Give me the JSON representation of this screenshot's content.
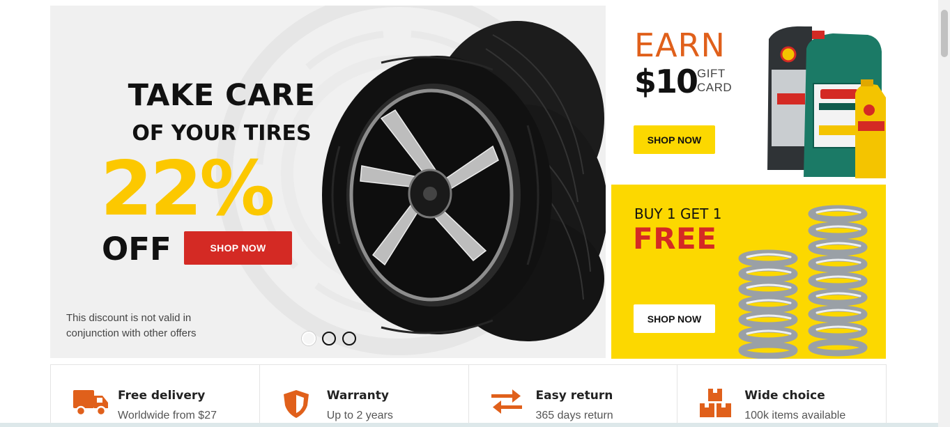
{
  "hero": {
    "title_line1": "TAKE CARE",
    "title_line2": "OF YOUR TIRES",
    "discount": "22%",
    "off": "OFF",
    "button": "SHOP NOW",
    "note": "This discount is not valid in conjunction with other offers",
    "slides_total": 3,
    "active_slide": 1,
    "colors": {
      "accent": "#fcc800",
      "button": "#d42a24"
    }
  },
  "promo_oil": {
    "earn": "EARN",
    "amount": "$10",
    "gift_line1": "GIFT",
    "gift_line2": "CARD",
    "button": "SHOP NOW",
    "colors": {
      "earn": "#e0601b",
      "button": "#fcd800"
    }
  },
  "promo_spring": {
    "buy": "BUY 1 GET 1",
    "free": "FREE",
    "button": "SHOP NOW",
    "colors": {
      "background": "#fcd800",
      "free": "#d42a24"
    }
  },
  "features": [
    {
      "icon": "truck-icon",
      "title": "Free delivery",
      "subtitle": "Worldwide from $27"
    },
    {
      "icon": "shield-icon",
      "title": "Warranty",
      "subtitle": "Up to 2 years"
    },
    {
      "icon": "exchange-arrows-icon",
      "title": "Easy return",
      "subtitle": "365 days return"
    },
    {
      "icon": "boxes-icon",
      "title": "Wide choice",
      "subtitle": "100k items available"
    }
  ],
  "feature_icon_color": "#e0601b"
}
